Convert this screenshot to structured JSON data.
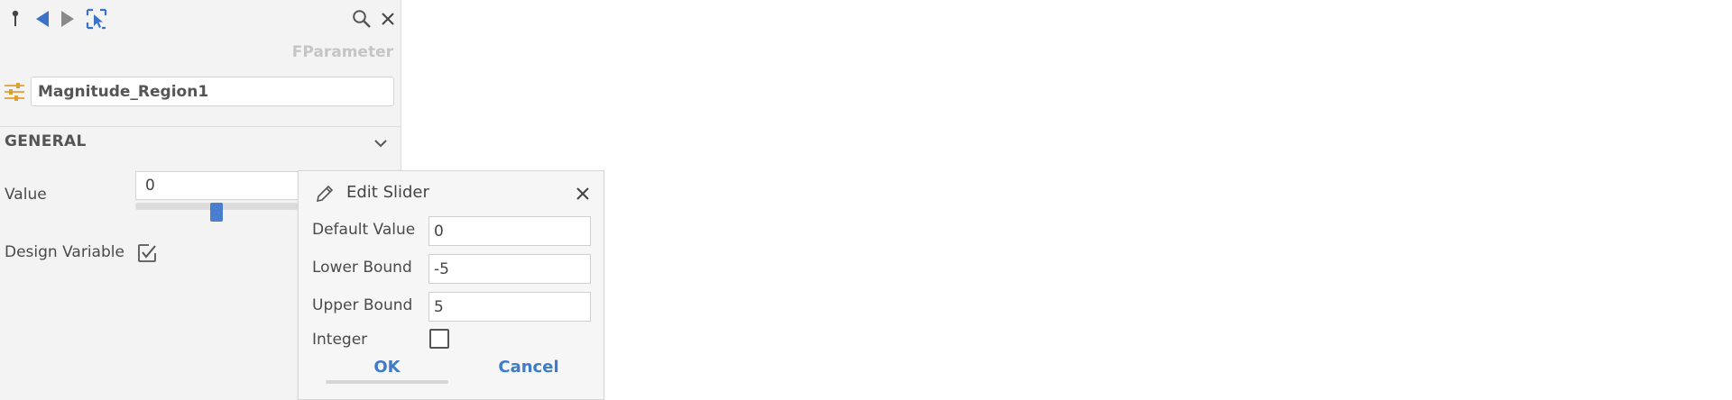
{
  "panel": {
    "type_label": "FParameter",
    "name_value": "Magnitude_Region1",
    "section_title": "GENERAL",
    "value_label": "Value",
    "value_input": "0",
    "slider_level": 0.5,
    "design_variable_label": "Design Variable",
    "design_variable_checked": true
  },
  "dialog": {
    "title": "Edit Slider",
    "default_value_label": "Default Value",
    "default_value": "0",
    "lower_bound_label": "Lower Bound",
    "lower_bound": "-5",
    "upper_bound_label": "Upper Bound",
    "upper_bound": "5",
    "integer_label": "Integer",
    "integer_checked": false,
    "ok_label": "OK",
    "cancel_label": "Cancel"
  },
  "icons": {
    "pin": "pin-icon",
    "back": "back-arrow-icon",
    "forward": "forward-arrow-icon",
    "select": "select-icon",
    "search": "search-icon",
    "close": "close-icon",
    "sliders": "sliders-icon",
    "chevron": "chevron-down-icon",
    "pencil": "pencil-icon"
  },
  "colors": {
    "accent_blue": "#3e7bc9",
    "slider_blue": "#4a7fd0",
    "sliders_icon_orange": "#e0a030",
    "panel_bg": "#f3f3f3"
  }
}
